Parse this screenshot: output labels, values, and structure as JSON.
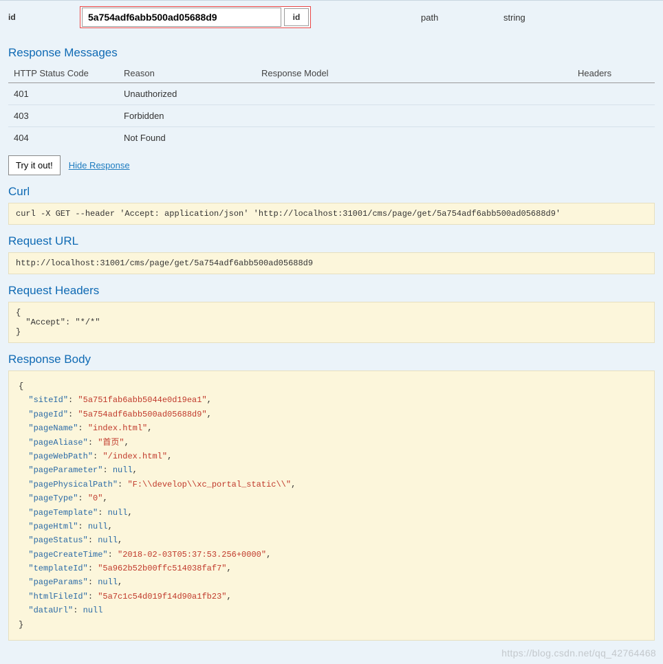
{
  "param": {
    "name": "id",
    "value": "5a754adf6abb500ad05688d9",
    "desc": "id",
    "paramType": "path",
    "dataType": "string"
  },
  "sections": {
    "responseMessages": "Response Messages",
    "curl": "Curl",
    "requestUrl": "Request URL",
    "requestHeaders": "Request Headers",
    "responseBody": "Response Body"
  },
  "msgHeaders": {
    "status": "HTTP Status Code",
    "reason": "Reason",
    "model": "Response Model",
    "headers": "Headers"
  },
  "messages": [
    {
      "code": "401",
      "reason": "Unauthorized"
    },
    {
      "code": "403",
      "reason": "Forbidden"
    },
    {
      "code": "404",
      "reason": "Not Found"
    }
  ],
  "actions": {
    "tryItOut": "Try it out!",
    "hideResponse": "Hide Response"
  },
  "curl": "curl -X GET --header 'Accept: application/json' 'http://localhost:31001/cms/page/get/5a754adf6abb500ad05688d9'",
  "requestUrl": "http://localhost:31001/cms/page/get/5a754adf6abb500ad05688d9",
  "requestHeaders": "{\n  \"Accept\": \"*/*\"\n}",
  "responseBody": [
    [
      "siteId",
      "str",
      "5a751fab6abb5044e0d19ea1"
    ],
    [
      "pageId",
      "str",
      "5a754adf6abb500ad05688d9"
    ],
    [
      "pageName",
      "str",
      "index.html"
    ],
    [
      "pageAliase",
      "str",
      "首页"
    ],
    [
      "pageWebPath",
      "str",
      "/index.html"
    ],
    [
      "pageParameter",
      "null",
      null
    ],
    [
      "pagePhysicalPath",
      "str",
      "F:\\\\develop\\\\xc_portal_static\\\\"
    ],
    [
      "pageType",
      "str",
      "0"
    ],
    [
      "pageTemplate",
      "null",
      null
    ],
    [
      "pageHtml",
      "null",
      null
    ],
    [
      "pageStatus",
      "null",
      null
    ],
    [
      "pageCreateTime",
      "str",
      "2018-02-03T05:37:53.256+0000"
    ],
    [
      "templateId",
      "str",
      "5a962b52b00ffc514038faf7"
    ],
    [
      "pageParams",
      "null",
      null
    ],
    [
      "htmlFileId",
      "str",
      "5a7c1c54d019f14d90a1fb23"
    ],
    [
      "dataUrl",
      "null",
      null
    ]
  ],
  "watermark": "https://blog.csdn.net/qq_42764468"
}
